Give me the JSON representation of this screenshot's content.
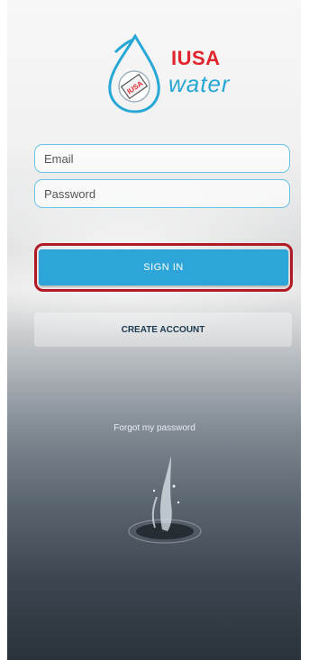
{
  "brand": {
    "line1": "IUSA",
    "line2": "water",
    "badge_text": "IUSA"
  },
  "form": {
    "email_placeholder": "Email",
    "password_placeholder": "Password"
  },
  "actions": {
    "signin_label": "SIGN IN",
    "create_account_label": "CREATE ACCOUNT",
    "forgot_label": "Forgot my password"
  },
  "colors": {
    "accent_blue": "#2ea5d8",
    "brand_red": "#e0262c",
    "highlight_outline": "#b11a25"
  }
}
